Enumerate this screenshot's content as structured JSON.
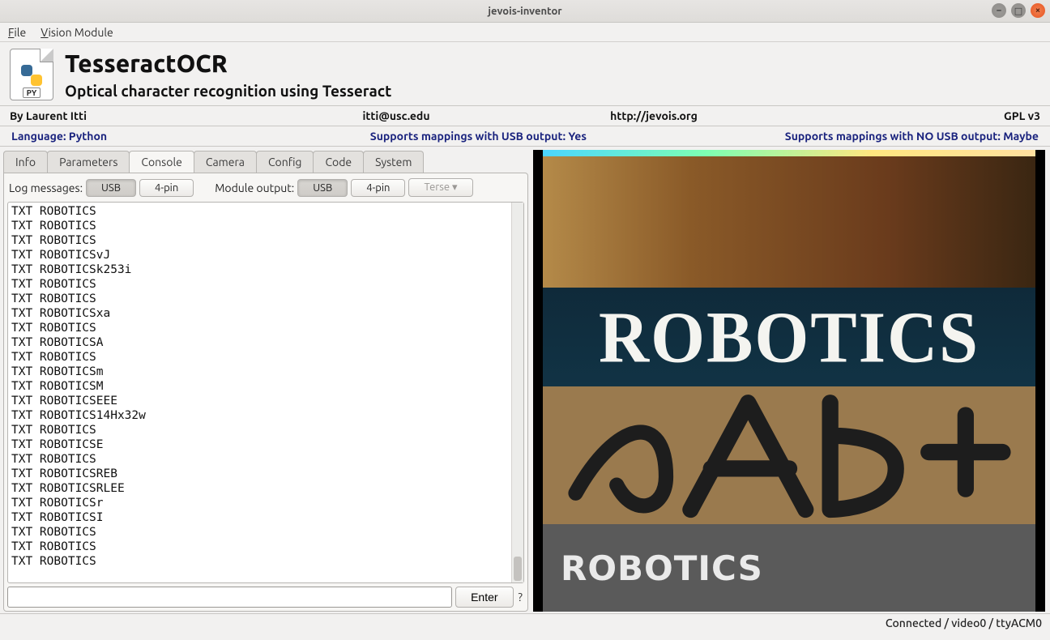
{
  "window": {
    "title": "jevois-inventor"
  },
  "menu": {
    "file": "File",
    "vision": "Vision Module"
  },
  "icon": {
    "py": "PY"
  },
  "header": {
    "title": "TesseractOCR",
    "subtitle": "Optical character recognition using Tesseract"
  },
  "meta": {
    "author": "By Laurent Itti",
    "email": "itti@usc.edu",
    "url": "http://jevois.org",
    "license": "GPL v3"
  },
  "supports": {
    "language": "Language: Python",
    "usb_out": "Supports mappings with USB output: Yes",
    "no_usb_out": "Supports mappings with NO USB output: Maybe"
  },
  "tabs": [
    "Info",
    "Parameters",
    "Console",
    "Camera",
    "Config",
    "Code",
    "System"
  ],
  "active_tab": "Console",
  "console": {
    "log_label": "Log messages:",
    "log_usb": "USB",
    "log_4pin": "4-pin",
    "mod_label": "Module output:",
    "mod_usb": "USB",
    "mod_4pin": "4-pin",
    "terse": "Terse",
    "enter": "Enter",
    "q": "?",
    "lines": [
      "TXT ROBOTICS",
      "TXT ROBOTICS",
      "TXT ROBOTICS",
      "TXT ROBOTICSvJ",
      "TXT ROBOTICSk253i",
      "TXT ROBOTICS",
      "TXT ROBOTICS",
      "TXT ROBOTICSxa",
      "TXT ROBOTICS",
      "TXT ROBOTICSA",
      "TXT ROBOTICS",
      "TXT ROBOTICSm",
      "TXT ROBOTICSM",
      "TXT ROBOTICSEEE",
      "TXT ROBOTICS14Hx32w",
      "TXT ROBOTICS",
      "TXT ROBOTICSE",
      "TXT ROBOTICS",
      "TXT ROBOTICSREB",
      "TXT ROBOTICSRLEE",
      "TXT ROBOTICSr",
      "TXT ROBOTICSI",
      "TXT ROBOTICS",
      "TXT ROBOTICS",
      "TXT ROBOTICS"
    ]
  },
  "camera": {
    "big": "ROBOTICS",
    "caption": "ROBOTICS"
  },
  "status": "Connected / video0 / ttyACM0"
}
